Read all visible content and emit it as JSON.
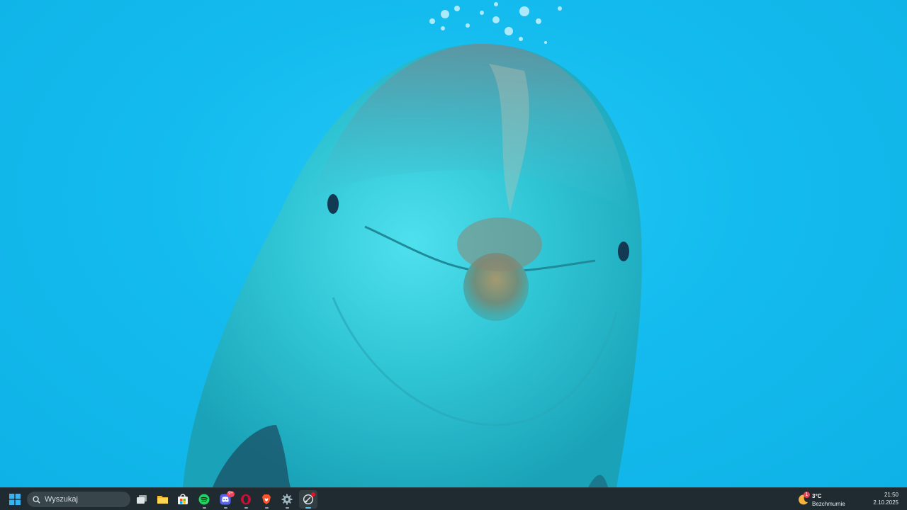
{
  "desktop": {
    "wallpaper": "dolphin-underwater",
    "background_color": "#12b8ea"
  },
  "taskbar": {
    "start_icon": "windows-logo-icon",
    "search": {
      "placeholder": "Wyszukaj",
      "icon": "search-icon"
    },
    "apps": [
      {
        "name": "Task View",
        "icon": "task-view-icon",
        "running": false
      },
      {
        "name": "File Explorer",
        "icon": "folder-icon",
        "running": false
      },
      {
        "name": "Microsoft Store",
        "icon": "store-icon",
        "running": false
      },
      {
        "name": "Spotify",
        "icon": "spotify-icon",
        "running": true
      },
      {
        "name": "Discord",
        "icon": "discord-icon",
        "running": true,
        "badge": "9+"
      },
      {
        "name": "Opera",
        "icon": "opera-icon",
        "running": true
      },
      {
        "name": "Brave",
        "icon": "brave-icon",
        "running": true
      },
      {
        "name": "Settings",
        "icon": "gear-icon",
        "running": true
      },
      {
        "name": "Snipping Tool",
        "icon": "snipping-tool-icon",
        "running": true,
        "active": true
      }
    ],
    "weather": {
      "alert_count": "1",
      "temp": "3°C",
      "condition": "Bezchmurnie",
      "icon": "moon-icon"
    },
    "clock": {
      "time": "21:50",
      "date": "2.10.2025"
    }
  }
}
